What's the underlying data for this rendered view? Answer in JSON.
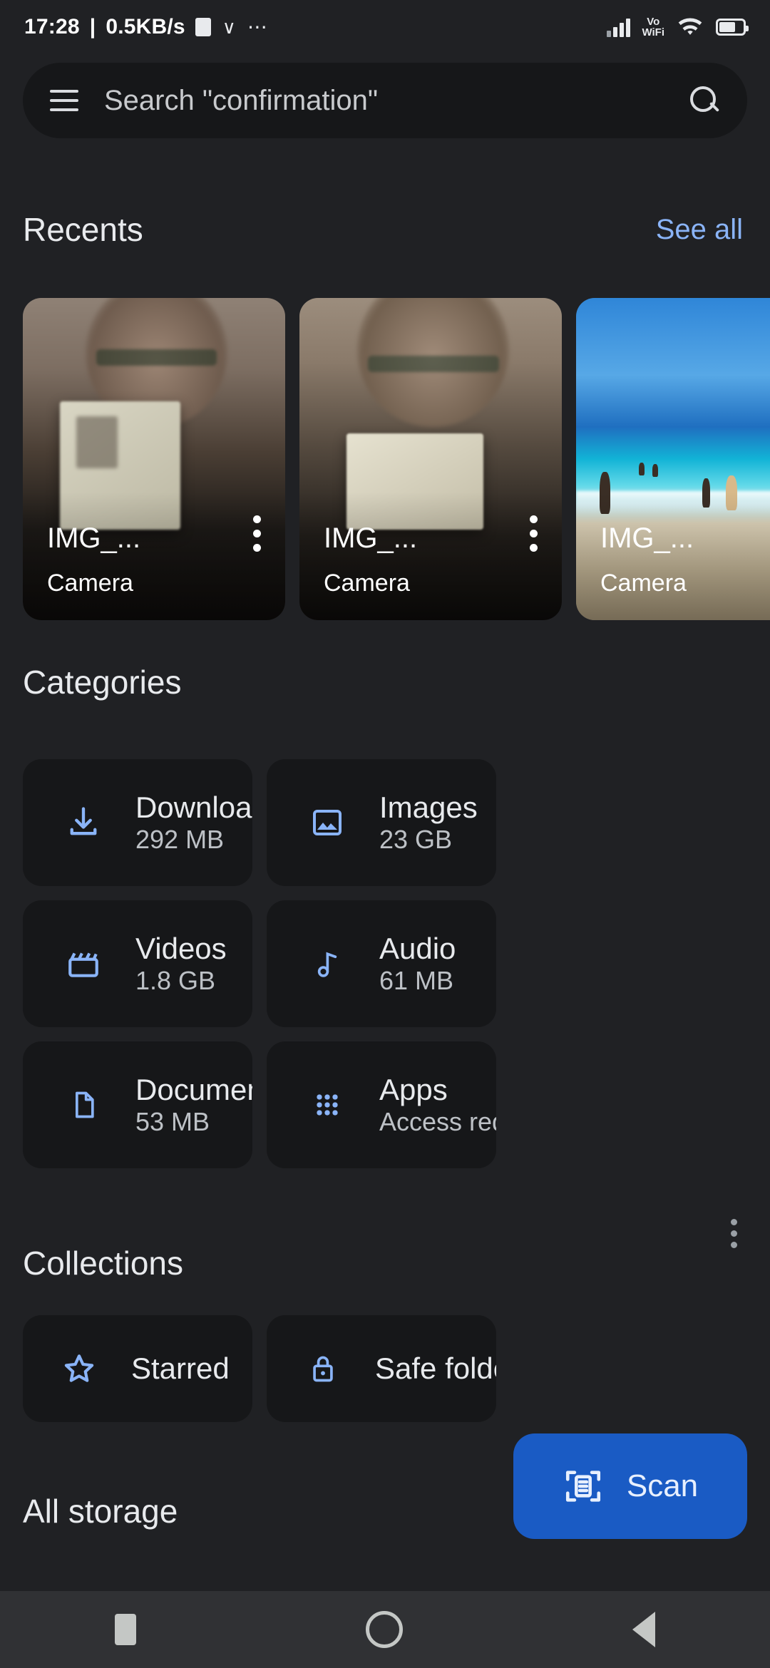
{
  "status_bar": {
    "clock": "17:28",
    "separator": "|",
    "network_speed": "0.5KB/s",
    "cast_icon": "cast-icon",
    "y_icon": "vpn-icon",
    "more_icon": "more-notifications-icon",
    "signal_icon": "cellular-signal-icon",
    "vowifi_line1": "Vo",
    "vowifi_line2": "WiFi",
    "wifi_icon": "wifi-icon",
    "battery_icon": "battery-icon"
  },
  "search": {
    "menu_icon": "hamburger-menu-icon",
    "placeholder": "Search \"confirmation\"",
    "search_icon": "search-icon"
  },
  "recents": {
    "title": "Recents",
    "see_all": "See all",
    "items": [
      {
        "name": "IMG_...",
        "source": "Camera",
        "menu_icon": "overflow-menu-icon",
        "photo": "portrait-document"
      },
      {
        "name": "IMG_...",
        "source": "Camera",
        "menu_icon": "overflow-menu-icon",
        "photo": "portrait-document-2"
      },
      {
        "name": "IMG_...",
        "source": "Camera",
        "menu_icon": "overflow-menu-icon",
        "photo": "beach"
      }
    ]
  },
  "categories": {
    "title": "Categories",
    "items": [
      {
        "label": "Downloads",
        "size": "292 MB",
        "icon": "download-icon"
      },
      {
        "label": "Images",
        "size": "23 GB",
        "icon": "image-icon"
      },
      {
        "label": "Videos",
        "size": "1.8 GB",
        "icon": "video-icon"
      },
      {
        "label": "Audio",
        "size": "61 MB",
        "icon": "music-note-icon"
      },
      {
        "label": "Documents",
        "size": "53 MB",
        "icon": "document-icon"
      },
      {
        "label": "Apps",
        "size": "Access required",
        "icon": "apps-grid-icon"
      }
    ]
  },
  "collections": {
    "title": "Collections",
    "menu_icon": "overflow-menu-icon",
    "items": [
      {
        "label": "Starred",
        "icon": "star-icon"
      },
      {
        "label": "Safe folder",
        "icon": "lock-icon"
      }
    ]
  },
  "all_storage": {
    "title": "All storage"
  },
  "scan_button": {
    "label": "Scan",
    "icon": "document-scan-icon"
  },
  "nav_bar": {
    "recents_icon": "square-recents-icon",
    "home_icon": "circle-home-icon",
    "back_icon": "triangle-back-icon"
  },
  "colors": {
    "background": "#202124",
    "tile": "#161719",
    "accent_blue": "#8ab4f8",
    "scan_blue": "#1a5bc4",
    "text_primary": "#e8eaed",
    "text_secondary": "#bdc1c6",
    "nav_bar": "#303134"
  }
}
